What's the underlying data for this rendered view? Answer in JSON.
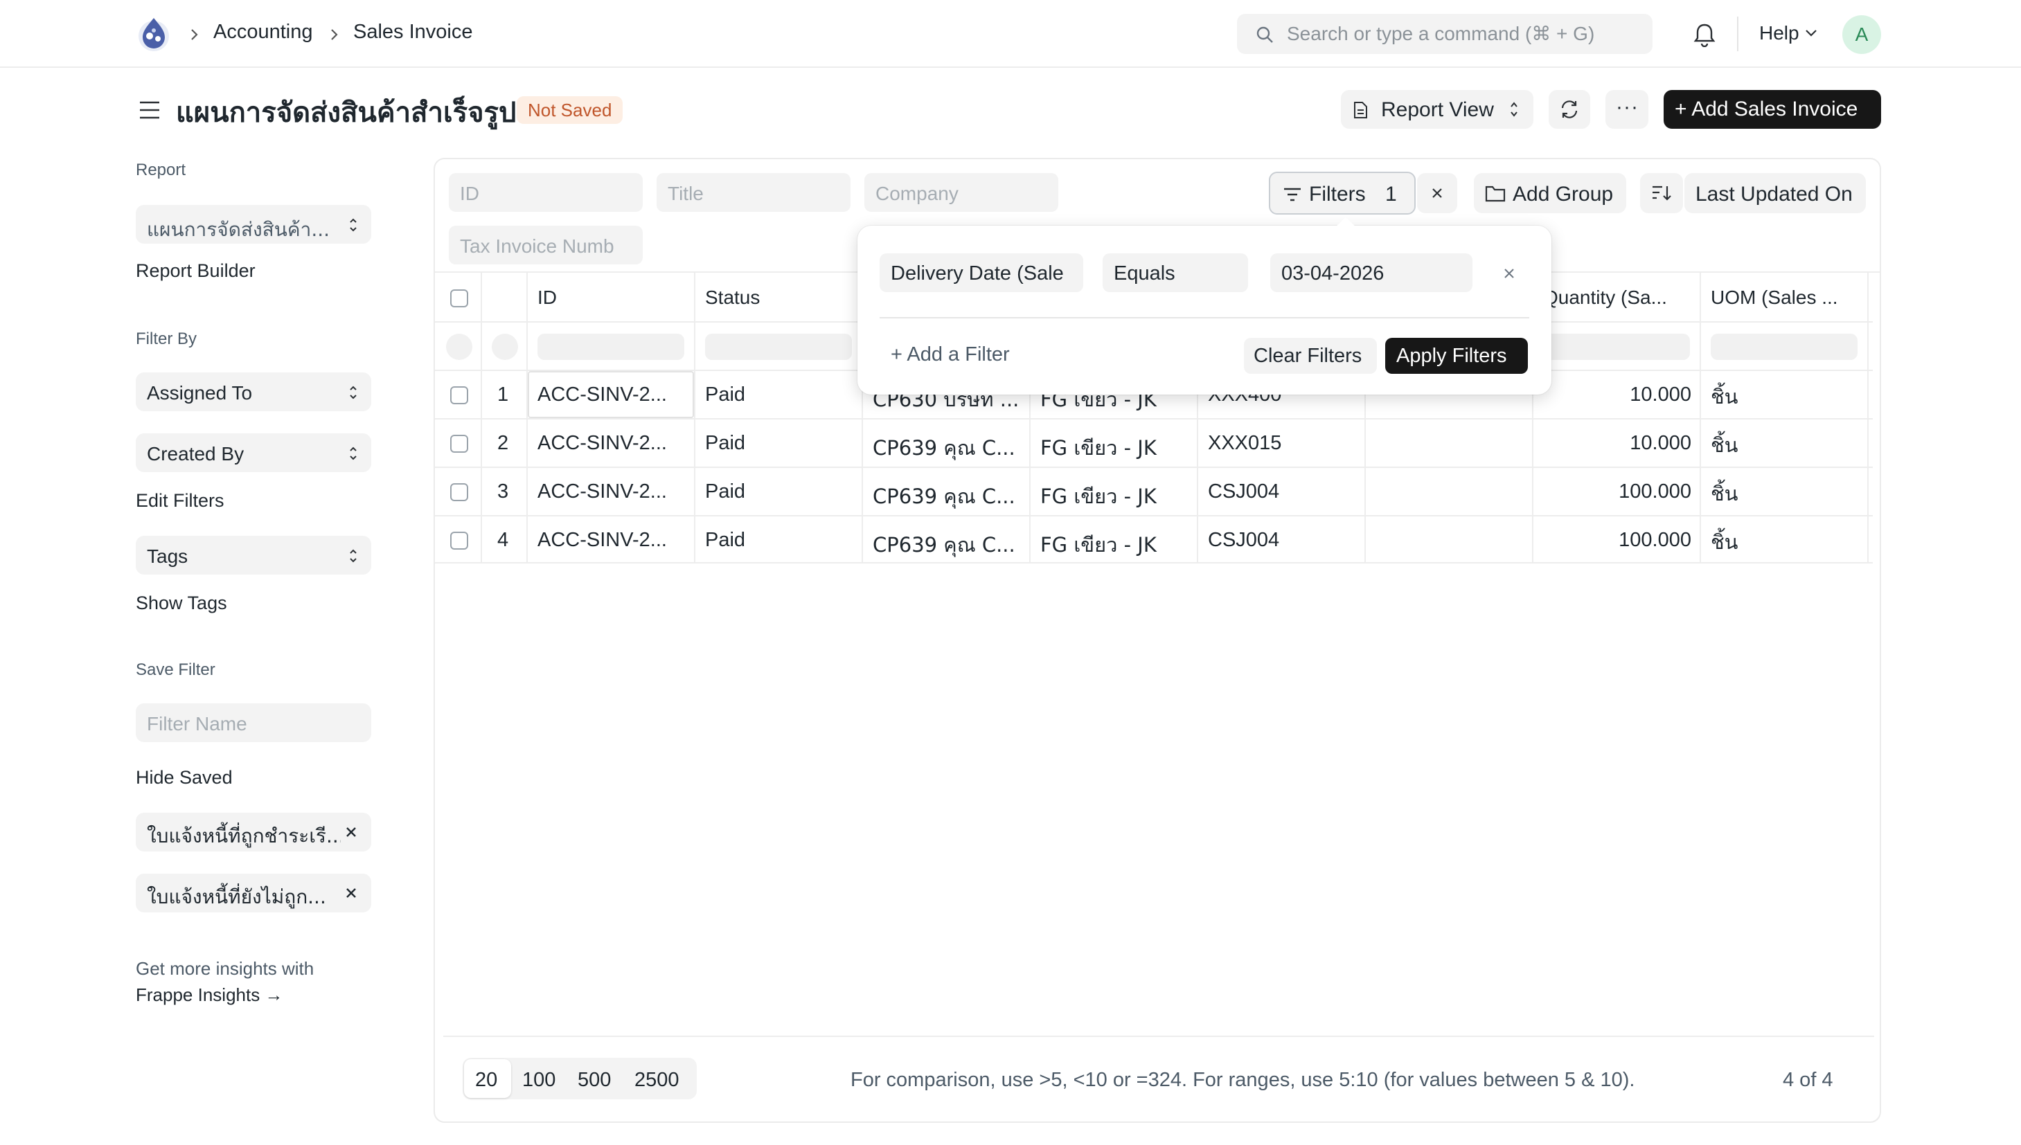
{
  "navbar": {
    "breadcrumbs": [
      "Accounting",
      "Sales Invoice"
    ],
    "search_placeholder": "Search or type a command (⌘ + G)",
    "help_label": "Help",
    "avatar_letter": "A"
  },
  "page": {
    "title": "แผนการจัดส่งสินค้าสำเร็จรูป",
    "status_badge": "Not Saved",
    "report_view_label": "Report View",
    "more_label": "···",
    "add_button_label": "+ Add Sales Invoice"
  },
  "sidebar": {
    "report_label": "Report",
    "report_select_value": "แผนการจัดส่งสินค้า...",
    "report_builder": "Report Builder",
    "filter_by_label": "Filter By",
    "assigned_to": "Assigned To",
    "created_by": "Created By",
    "edit_filters": "Edit Filters",
    "tags": "Tags",
    "show_tags": "Show Tags",
    "save_filter_label": "Save Filter",
    "filter_name_placeholder": "Filter Name",
    "hide_saved": "Hide Saved",
    "saved_filters": [
      "ใบแจ้งหนี้ที่ถูกชำระเรี...",
      "ใบแจ้งหนี้ที่ยังไม่ถูก..."
    ],
    "insights_line1": "Get more insights with",
    "insights_line2": "Frappe Insights →"
  },
  "toolbar": {
    "filter_inputs": [
      "ID",
      "Title",
      "Company",
      "Tax Invoice Numb"
    ],
    "filters_label": "Filters",
    "filters_count": "1",
    "add_group_label": "Add Group",
    "sort_label": "Last Updated On"
  },
  "filter_popover": {
    "field": "Delivery Date (Sale",
    "condition": "Equals",
    "value": "03-04-2026",
    "add_filter": "+ Add a Filter",
    "clear_filters": "Clear Filters",
    "apply_filters": "Apply Filters"
  },
  "table": {
    "headers": [
      "ID",
      "Status",
      "Quantity (Sa...",
      "UOM (Sales ..."
    ],
    "rows": [
      {
        "num": "1",
        "id": "ACC-SINV-2...",
        "status": "Paid",
        "customer": "CP630 บริษัท ...",
        "item": "FG เขียว - JK",
        "code": "XXX400",
        "qty": "10.000",
        "uom": "ชิ้น"
      },
      {
        "num": "2",
        "id": "ACC-SINV-2...",
        "status": "Paid",
        "customer": "CP639 คุณ C...",
        "item": "FG เขียว - JK",
        "code": "XXX015",
        "qty": "10.000",
        "uom": "ชิ้น"
      },
      {
        "num": "3",
        "id": "ACC-SINV-2...",
        "status": "Paid",
        "customer": "CP639 คุณ C...",
        "item": "FG เขียว - JK",
        "code": "CSJ004",
        "qty": "100.000",
        "uom": "ชิ้น"
      },
      {
        "num": "4",
        "id": "ACC-SINV-2...",
        "status": "Paid",
        "customer": "CP639 คุณ C...",
        "item": "FG เขียว - JK",
        "code": "CSJ004",
        "qty": "100.000",
        "uom": "ชิ้น"
      }
    ]
  },
  "footer": {
    "page_sizes": [
      "20",
      "100",
      "500",
      "2500"
    ],
    "hint": "For comparison, use >5, <10 or =324. For ranges, use 5:10 (for values between 5 & 10).",
    "count": "4 of 4"
  },
  "colors": {
    "primary_button": "#171717",
    "badge_bg": "#fdeee3",
    "badge_text": "#c0562b",
    "field_bg": "#f3f3f3"
  }
}
